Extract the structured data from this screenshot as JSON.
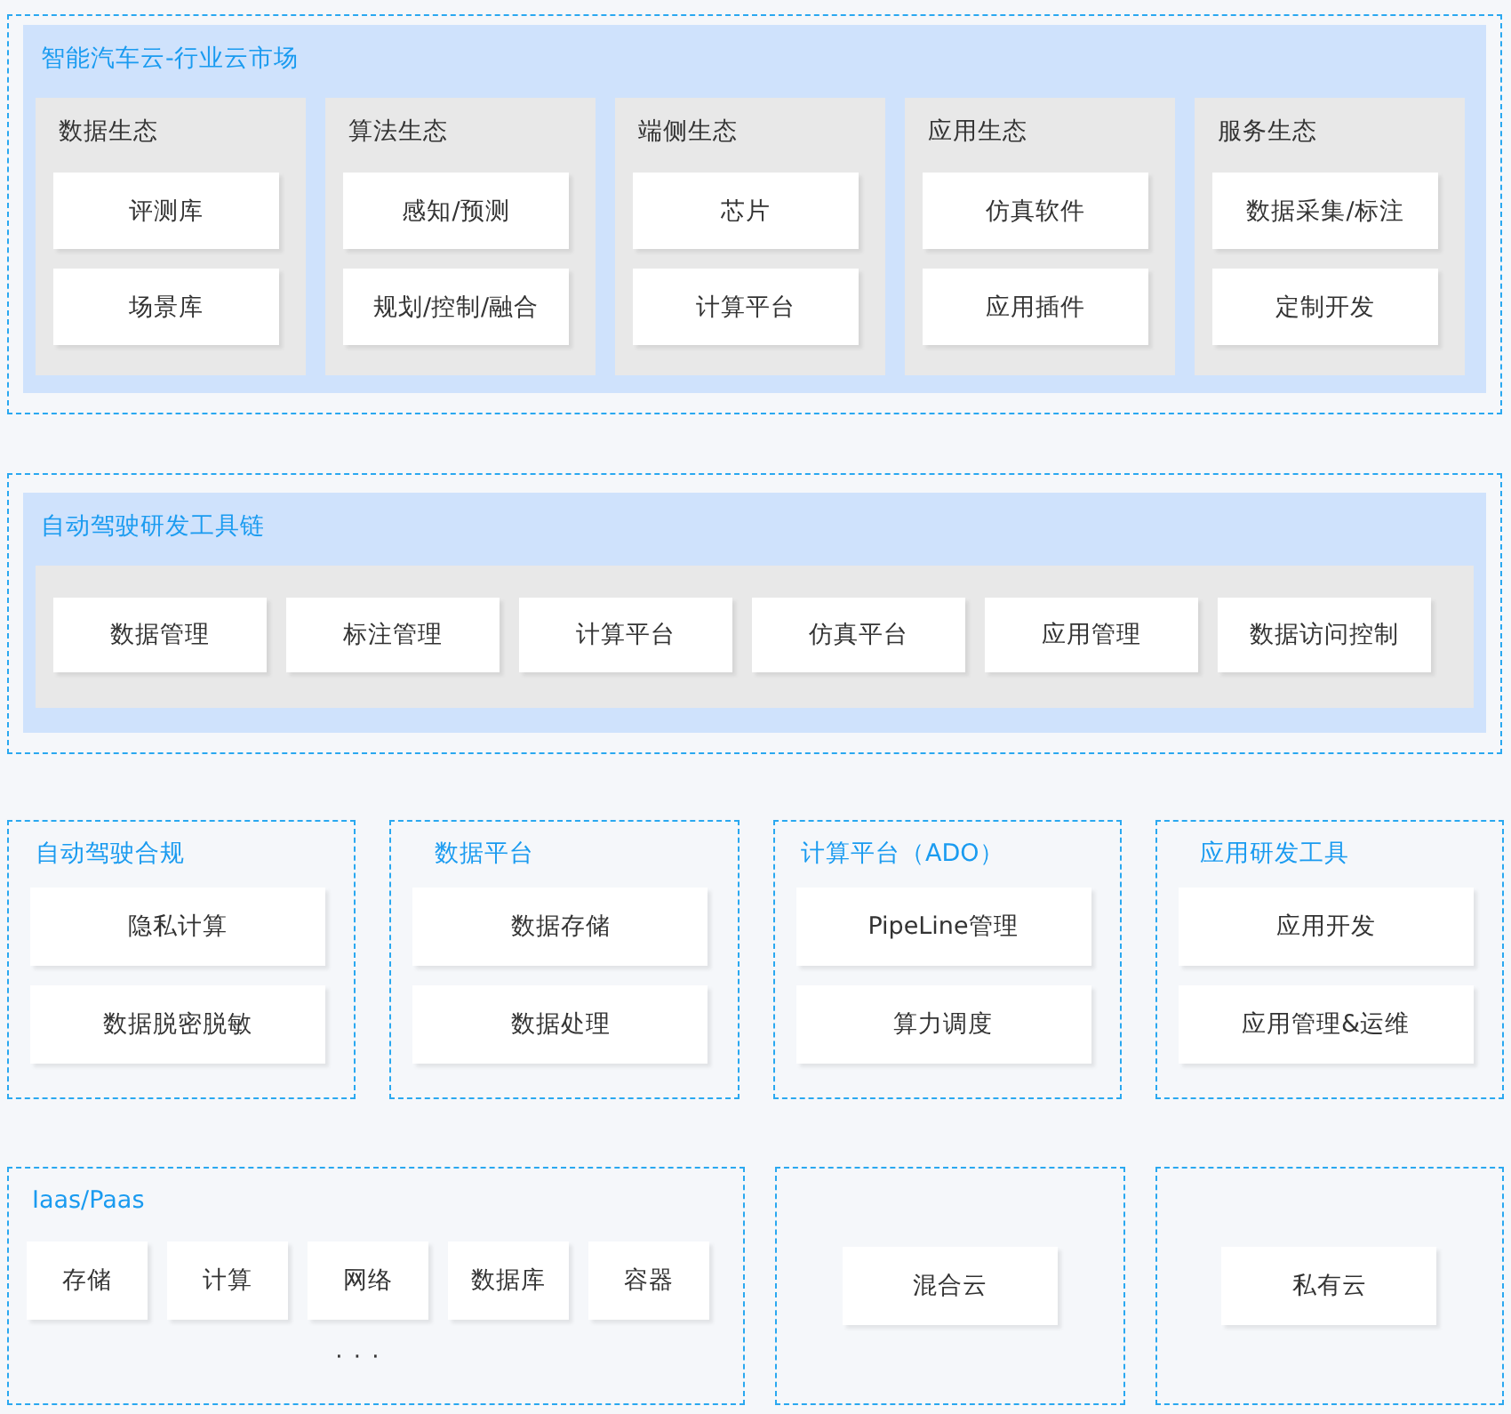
{
  "market": {
    "title": "智能汽车云-行业云市场",
    "groups": [
      {
        "title": "数据生态",
        "items": [
          "评测库",
          "场景库"
        ]
      },
      {
        "title": "算法生态",
        "items": [
          "感知/预测",
          "规划/控制/融合"
        ]
      },
      {
        "title": "端侧生态",
        "items": [
          "芯片",
          "计算平台"
        ]
      },
      {
        "title": "应用生态",
        "items": [
          "仿真软件",
          "应用插件"
        ]
      },
      {
        "title": "服务生态",
        "items": [
          "数据采集/标注",
          "定制开发"
        ]
      }
    ]
  },
  "toolchain": {
    "title": "自动驾驶研发工具链",
    "items": [
      "数据管理",
      "标注管理",
      "计算平台",
      "仿真平台",
      "应用管理",
      "数据访问控制"
    ]
  },
  "platforms": [
    {
      "title": "自动驾驶合规",
      "items": [
        "隐私计算",
        "数据脱密脱敏"
      ]
    },
    {
      "title": "数据平台",
      "items": [
        "数据存储",
        "数据处理"
      ]
    },
    {
      "title": "计算平台（ADO）",
      "items": [
        "PipeLine管理",
        "算力调度"
      ]
    },
    {
      "title": "应用研发工具",
      "items": [
        "应用开发",
        "应用管理&运维"
      ]
    }
  ],
  "infrastructure": [
    {
      "kind": "grid",
      "title": "Iaas/Paas",
      "items": [
        "存储",
        "计算",
        "网络",
        "数据库",
        "容器"
      ],
      "more": "· · ·"
    },
    {
      "kind": "single",
      "items": [
        "混合云"
      ]
    },
    {
      "kind": "single",
      "items": [
        "私有云"
      ]
    }
  ]
}
